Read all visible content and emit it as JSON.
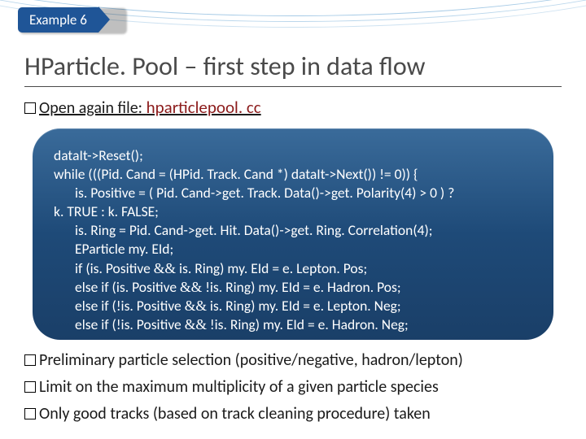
{
  "badge": {
    "label": "Example 6"
  },
  "title": "HParticle. Pool – first step in data flow",
  "filename": "hparticlepool. cc",
  "bullets_top": [
    {
      "prefix": "Open again file: "
    }
  ],
  "code": {
    "lines": [
      {
        "indent": 0,
        "text": "dataIt->Reset();"
      },
      {
        "indent": 0,
        "text": "while (((Pid. Cand = (HPid. Track. Cand *) dataIt->Next()) != 0))   {"
      },
      {
        "indent": 1,
        "text": "is. Positive = ( Pid. Cand->get. Track. Data()->get. Polarity(4) > 0 ) ?"
      },
      {
        "indent": 0,
        "text": "k. TRUE : k. FALSE;"
      },
      {
        "indent": 1,
        "text": "is. Ring = Pid. Cand->get. Hit. Data()->get. Ring. Correlation(4);"
      },
      {
        "indent": 1,
        "text": "EParticle my. EId;"
      },
      {
        "indent": 1,
        "text": "if (is. Positive && is. Ring) my. EId = e. Lepton. Pos;"
      },
      {
        "indent": 1,
        "text": "else if (is. Positive && !is. Ring) my. EId = e. Hadron. Pos;"
      },
      {
        "indent": 1,
        "text": "else if (!is. Positive && is. Ring) my. EId = e. Lepton. Neg;"
      },
      {
        "indent": 1,
        "text": "else if (!is. Positive && !is. Ring) my. EId = e. Hadron. Neg;"
      }
    ]
  },
  "bullets_bottom": [
    "Preliminary particle selection (positive/negative, hadron/lepton)",
    "Limit on the maximum multiplicity of a given particle species",
    "Only good tracks (based on track cleaning procedure) taken"
  ]
}
